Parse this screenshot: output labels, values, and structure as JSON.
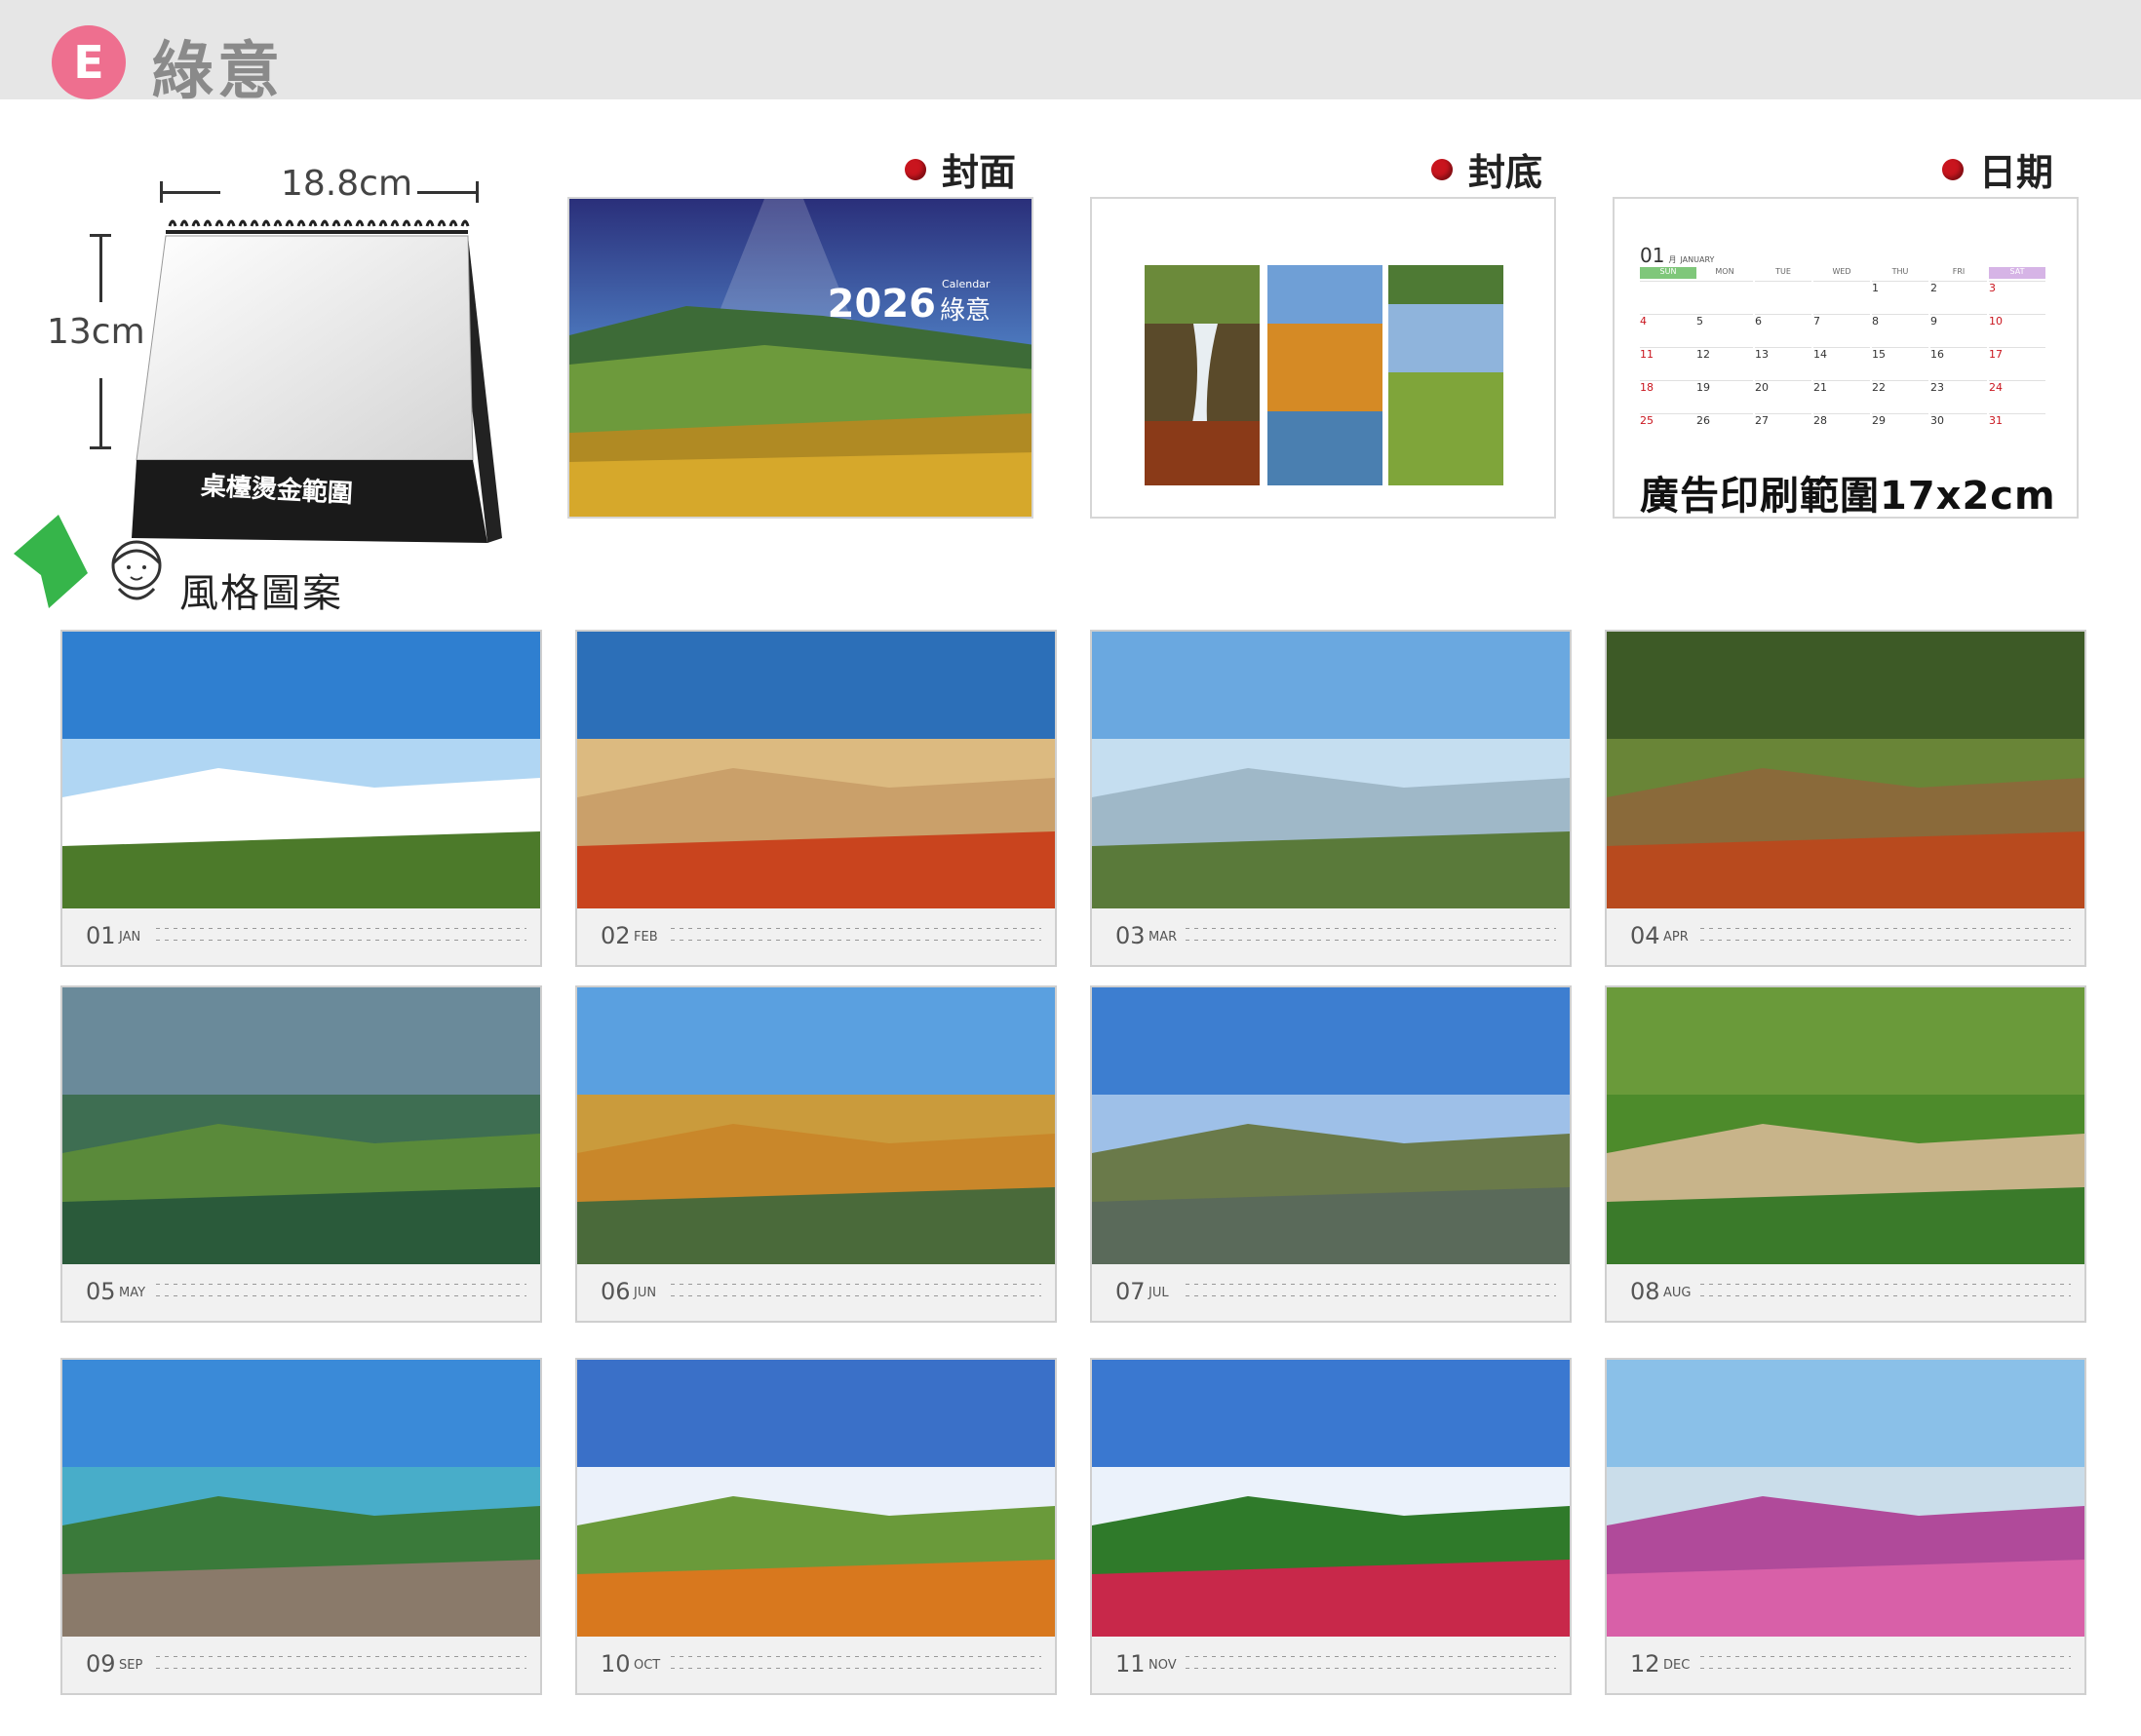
{
  "header": {
    "badge": "E",
    "style_name": "綠意"
  },
  "size_diagram": {
    "width_label": "18.8cm",
    "height_label": "13cm",
    "base_label": "桌檯燙金範圍"
  },
  "sections": {
    "cover_label": "封面",
    "back_label": "封底",
    "date_label": "日期"
  },
  "cover": {
    "year": "2026",
    "calendar_word": "Calendar",
    "name": "綠意"
  },
  "date_page": {
    "month": "01",
    "month_cn": "月",
    "month_en": "JANUARY",
    "weekdays": [
      "SUN",
      "MON",
      "TUE",
      "WED",
      "THU",
      "FRI",
      "SAT"
    ],
    "weeks": [
      [
        "",
        "",
        "",
        "",
        "1",
        "2",
        "3"
      ],
      [
        "4",
        "5",
        "6",
        "7",
        "8",
        "9",
        "10"
      ],
      [
        "11",
        "12",
        "13",
        "14",
        "15",
        "16",
        "17"
      ],
      [
        "18",
        "19",
        "20",
        "21",
        "22",
        "23",
        "24"
      ],
      [
        "25",
        "26",
        "27",
        "28",
        "29",
        "30",
        "31"
      ]
    ],
    "ad_text": "廣告印刷範圍17x2cm"
  },
  "pattern_label": "風格圖案",
  "months": [
    {
      "num": "01",
      "abbr": "JAN"
    },
    {
      "num": "02",
      "abbr": "FEB"
    },
    {
      "num": "03",
      "abbr": "MAR"
    },
    {
      "num": "04",
      "abbr": "APR"
    },
    {
      "num": "05",
      "abbr": "MAY"
    },
    {
      "num": "06",
      "abbr": "JUN"
    },
    {
      "num": "07",
      "abbr": "JUL"
    },
    {
      "num": "08",
      "abbr": "AUG"
    },
    {
      "num": "09",
      "abbr": "SEP"
    },
    {
      "num": "10",
      "abbr": "OCT"
    },
    {
      "num": "11",
      "abbr": "NOV"
    },
    {
      "num": "12",
      "abbr": "DEC"
    }
  ],
  "colors": {
    "badge": "#ee6f8f",
    "dot": "#c9151e",
    "sat_header": "#d6b4e6",
    "sun_header": "#7fc77a"
  }
}
